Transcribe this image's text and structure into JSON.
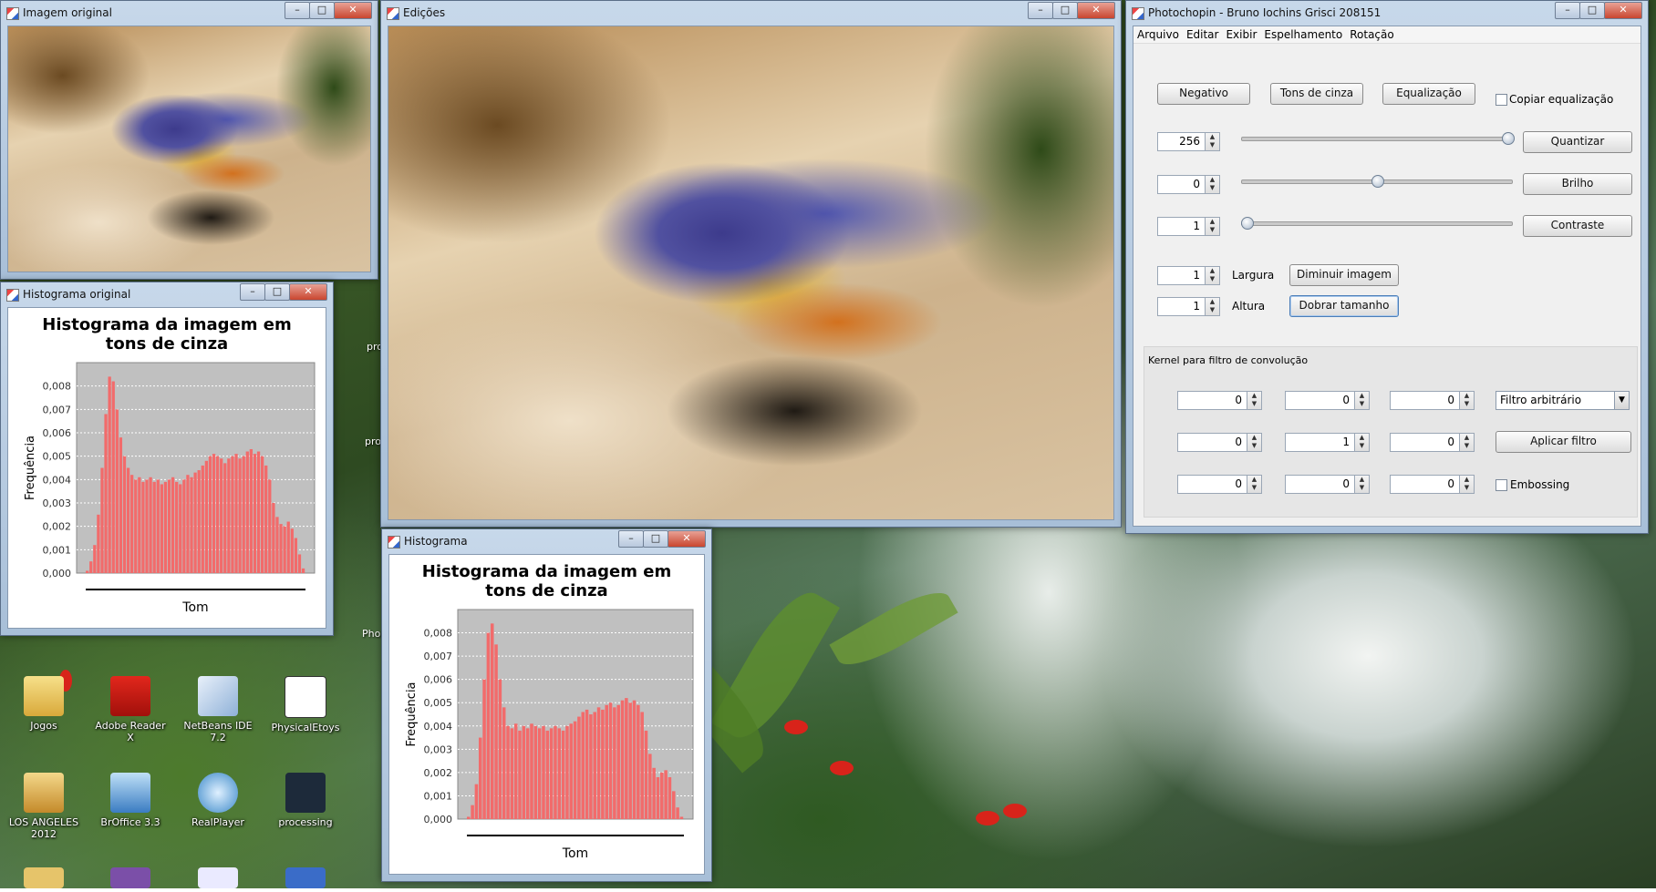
{
  "desktop": {
    "icons": [
      {
        "label": "Jogos"
      },
      {
        "label": "Adobe Reader X"
      },
      {
        "label": "NetBeans IDE 7.2"
      },
      {
        "label": "PhysicalEtoys"
      },
      {
        "label": "LOS ANGELES 2012"
      },
      {
        "label": "BrOffice 3.3"
      },
      {
        "label": "RealPlayer"
      },
      {
        "label": "processing"
      }
    ],
    "peek_labels": [
      "pro",
      "pro",
      "Pho"
    ]
  },
  "windows": {
    "original_image": {
      "title": "Imagem original"
    },
    "edits": {
      "title": "Edições"
    },
    "original_histogram": {
      "title": "Histograma original"
    },
    "histogram": {
      "title": "Histograma"
    },
    "photochopin": {
      "title": "Photochopin - Bruno Iochins Grisci 208151"
    }
  },
  "window_buttons": {
    "minimize": "–",
    "maximize": "□",
    "close": "✕"
  },
  "chart_data": [
    {
      "type": "bar",
      "title": "Histograma da imagem em tons de cinza",
      "xlabel": "Tom",
      "ylabel": "Frequência",
      "ylim": [
        0,
        0.009
      ],
      "yticks": [
        "0,008",
        "0,007",
        "0,006",
        "0,005",
        "0,004",
        "0,003",
        "0,002",
        "0,001",
        "0,000"
      ],
      "xlim": [
        0,
        255
      ],
      "grid": true,
      "values": [
        0.0001,
        0.0005,
        0.0012,
        0.0025,
        0.0045,
        0.0068,
        0.0084,
        0.0082,
        0.007,
        0.0058,
        0.005,
        0.0045,
        0.0042,
        0.004,
        0.0041,
        0.0039,
        0.004,
        0.0041,
        0.0039,
        0.004,
        0.0038,
        0.0039,
        0.004,
        0.0041,
        0.0039,
        0.0038,
        0.004,
        0.0042,
        0.0041,
        0.0043,
        0.0044,
        0.0046,
        0.0048,
        0.005,
        0.0051,
        0.005,
        0.0049,
        0.0047,
        0.0049,
        0.005,
        0.0051,
        0.0049,
        0.005,
        0.0052,
        0.0053,
        0.0051,
        0.0052,
        0.005,
        0.0046,
        0.004,
        0.003,
        0.0024,
        0.0021,
        0.002,
        0.0022,
        0.0019,
        0.0015,
        0.0008,
        0.0002
      ]
    },
    {
      "type": "bar",
      "title": "Histograma da imagem em tons de cinza",
      "xlabel": "Tom",
      "ylabel": "Frequência",
      "ylim": [
        0,
        0.009
      ],
      "yticks": [
        "0,008",
        "0,007",
        "0,006",
        "0,005",
        "0,004",
        "0,003",
        "0,002",
        "0,001",
        "0,000"
      ],
      "xlim": [
        0,
        255
      ],
      "grid": true,
      "values": [
        0.0001,
        0.0006,
        0.0015,
        0.0035,
        0.006,
        0.008,
        0.0084,
        0.0075,
        0.006,
        0.0048,
        0.004,
        0.0039,
        0.0041,
        0.0038,
        0.004,
        0.0039,
        0.0041,
        0.004,
        0.0039,
        0.004,
        0.0038,
        0.0039,
        0.004,
        0.0039,
        0.0038,
        0.004,
        0.0041,
        0.0042,
        0.0044,
        0.0046,
        0.0047,
        0.0045,
        0.0046,
        0.0048,
        0.0047,
        0.0049,
        0.005,
        0.0048,
        0.0049,
        0.0051,
        0.0052,
        0.005,
        0.0051,
        0.0049,
        0.0046,
        0.0038,
        0.0028,
        0.0022,
        0.0018,
        0.002,
        0.0021,
        0.0018,
        0.0012,
        0.0005,
        0.0001
      ]
    }
  ],
  "photochopin": {
    "menu": [
      "Arquivo",
      "Editar",
      "Exibir",
      "Espelhamento",
      "Rotação"
    ],
    "buttons": {
      "negative": "Negativo",
      "grayscale": "Tons de cinza",
      "equalize": "Equalização",
      "quantize": "Quantizar",
      "brightness": "Brilho",
      "contrast": "Contraste",
      "shrink": "Diminuir imagem",
      "double": "Dobrar tamanho",
      "apply_filter": "Aplicar filtro"
    },
    "copy_equalization": {
      "label": "Copiar equalização",
      "checked": false
    },
    "quantize_value": "256",
    "quantize_level": 1.0,
    "brightness_value": "0",
    "brightness_level": 0.5,
    "contrast_value": "1",
    "contrast_level": 0.0,
    "width": {
      "value": "1",
      "label": "Largura"
    },
    "height": {
      "value": "1",
      "label": "Altura"
    },
    "kernel_title": "Kernel para filtro de convolução",
    "kernel": [
      [
        "0",
        "0",
        "0"
      ],
      [
        "0",
        "1",
        "0"
      ],
      [
        "0",
        "0",
        "0"
      ]
    ],
    "filter_select": "Filtro arbitrário",
    "embossing": {
      "label": "Embossing",
      "checked": false
    },
    "spin_up": "▲",
    "spin_down": "▼",
    "combo_arrow": "▼"
  }
}
